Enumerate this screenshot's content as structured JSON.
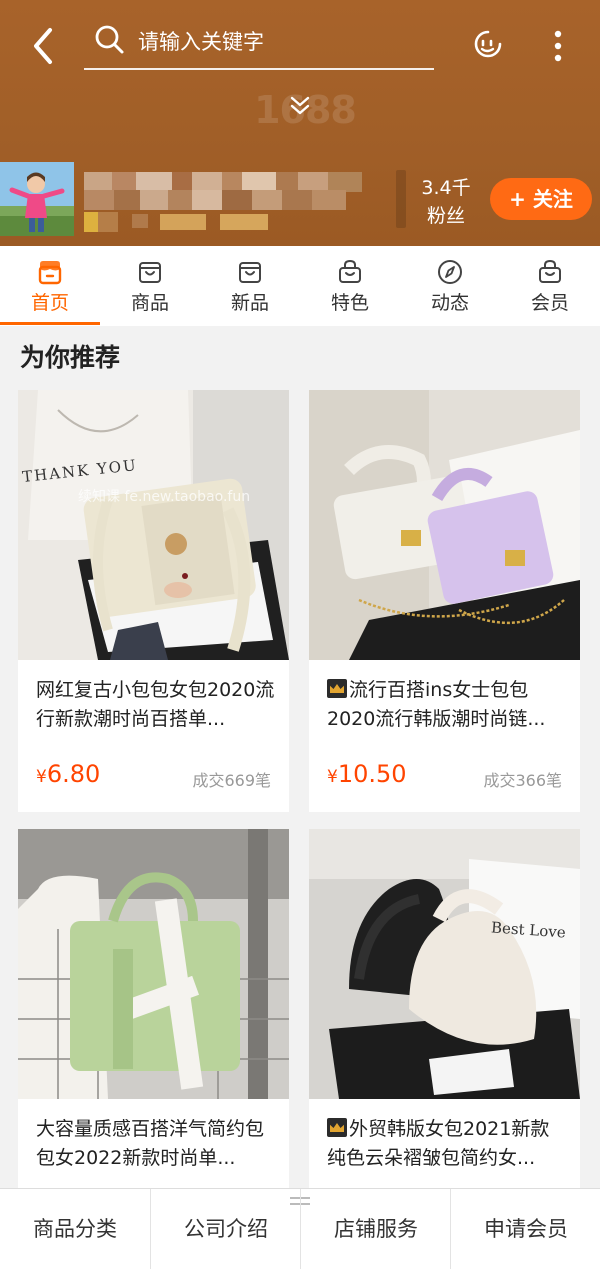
{
  "header": {
    "search_placeholder": "请输入关键字",
    "watermark": "1688",
    "fans_count": "3.4千",
    "fans_label": "粉丝",
    "follow_label": "+ 关注"
  },
  "tabs": [
    {
      "label": "首页",
      "active": true,
      "icon": "home-icon"
    },
    {
      "label": "商品",
      "icon": "shop-icon"
    },
    {
      "label": "新品",
      "icon": "new-icon"
    },
    {
      "label": "特色",
      "icon": "bag-icon"
    },
    {
      "label": "动态",
      "icon": "compass-icon"
    },
    {
      "label": "会员",
      "icon": "member-bag-icon"
    }
  ],
  "section": {
    "title": "为你推荐"
  },
  "products": [
    {
      "title": "网红复古小包包女包2020流行新款潮时尚百搭单...",
      "price_symbol": "¥",
      "price": "6.80",
      "sold": "成交669笔",
      "crown": false,
      "image_text": "THANK YOU",
      "overlay_text": "续知课 fe.new.taobao.fun"
    },
    {
      "title": "流行百搭ins女士包包2020流行韩版潮时尚链...",
      "price_symbol": "¥",
      "price": "10.50",
      "sold": "成交366笔",
      "crown": true
    },
    {
      "title": "大容量质感百搭洋气简约包包女2022新款时尚单...",
      "crown": false
    },
    {
      "title": "外贸韩版女包2021新款纯色云朵褶皱包简约女...",
      "crown": true,
      "image_text": "Best Love"
    }
  ],
  "bottom_nav": [
    "商品分类",
    "公司介绍",
    "店铺服务",
    "申请会员"
  ],
  "colors": {
    "header_bg": "#a1602a",
    "accent": "#ff6600",
    "price": "#ff4400",
    "follow_bg": "#ff6a14"
  }
}
